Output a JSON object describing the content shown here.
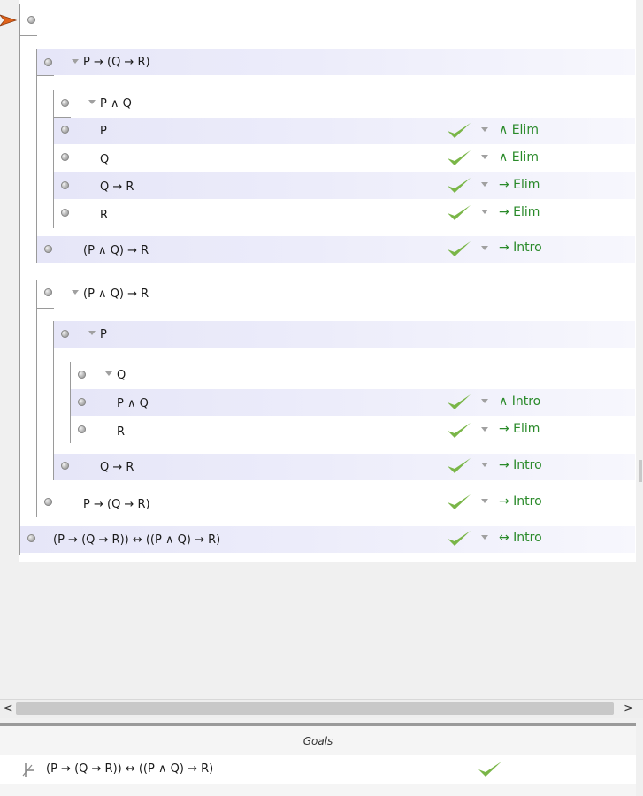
{
  "proof": {
    "rows": [
      {
        "sentence": "",
        "rule": ""
      },
      {
        "sentence": "P → (Q → R)",
        "rule": ""
      },
      {
        "sentence": "P ∧ Q",
        "rule": ""
      },
      {
        "sentence": "P",
        "rule": "∧ Elim"
      },
      {
        "sentence": "Q",
        "rule": "∧ Elim"
      },
      {
        "sentence": "Q → R",
        "rule": "→ Elim"
      },
      {
        "sentence": "R",
        "rule": "→ Elim"
      },
      {
        "sentence": "(P ∧ Q)  →  R",
        "rule": "→ Intro"
      },
      {
        "sentence": "(P ∧ Q)  →  R",
        "rule": ""
      },
      {
        "sentence": "P",
        "rule": ""
      },
      {
        "sentence": "Q",
        "rule": ""
      },
      {
        "sentence": "P ∧ Q",
        "rule": "∧ Intro"
      },
      {
        "sentence": "R",
        "rule": "→ Elim"
      },
      {
        "sentence": "Q → R",
        "rule": "→ Intro"
      },
      {
        "sentence": "P → (Q → R)",
        "rule": "→ Intro"
      },
      {
        "sentence": "(P → (Q → R)) ↔ ((P ∧ Q) → R)",
        "rule": "↔ Intro"
      }
    ]
  },
  "scrollbar": {
    "left_arrow": "<",
    "right_arrow": ">"
  },
  "goals": {
    "header": "Goals",
    "items": [
      {
        "sentence": "(P → (Q → R)) ↔ ((P ∧ Q) → R)"
      }
    ]
  },
  "colors": {
    "highlight": "#e6e6f8",
    "rule_text": "#2a8a2a",
    "check": "#7ab648",
    "pointer": "#e0621a"
  },
  "icons": {
    "pointer": "focus-pointer-icon",
    "step_dot": "step-bullet-icon",
    "check": "checkmark-icon",
    "rule_menu": "rule-menu-triangle-icon",
    "goal": "goal-turnstile-icon"
  }
}
